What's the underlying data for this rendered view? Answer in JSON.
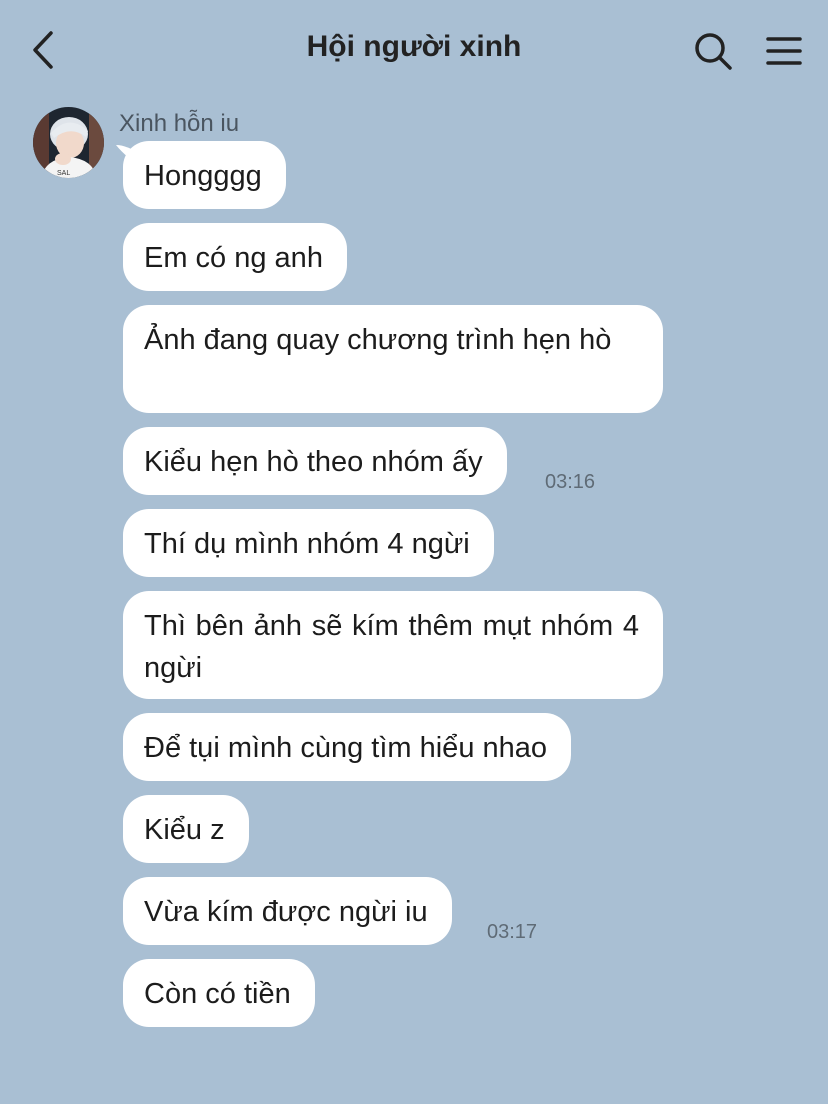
{
  "header": {
    "title": "Hội người xinh"
  },
  "sender": {
    "name": "Xinh hỗn iu"
  },
  "messages": [
    {
      "text": "Hongggg"
    },
    {
      "text": "Em có ng anh"
    },
    {
      "text": "Ảnh đang quay chương trình hẹn hò"
    },
    {
      "text": "Kiểu hẹn hò theo nhóm ấy",
      "time": "03:16"
    },
    {
      "text": "Thí dụ mình nhóm 4 ngừi"
    },
    {
      "text": "Thì bên ảnh sẽ kím thêm mụt nhóm 4 ngừi"
    },
    {
      "text": "Để tụi mình cùng tìm hiểu nhao"
    },
    {
      "text": "Kiểu z"
    },
    {
      "text": "Vừa kím được ngừi iu",
      "time": "03:17"
    },
    {
      "text": "Còn có tiền"
    }
  ],
  "colors": {
    "background": "#a9bfd3",
    "bubble": "#ffffff"
  }
}
